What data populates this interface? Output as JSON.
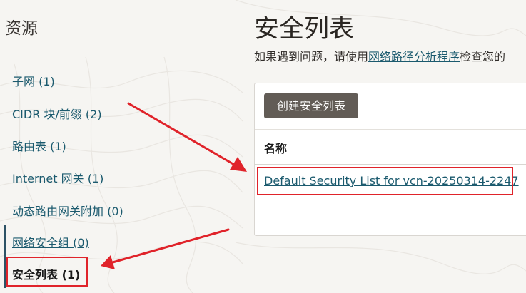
{
  "sidebar": {
    "title": "资源",
    "items": [
      {
        "label": "子网 (1)"
      },
      {
        "label": "CIDR 块/前缀 (2)"
      },
      {
        "label": "路由表 (1)"
      },
      {
        "label": "Internet 网关 (1)"
      },
      {
        "label": "动态路由网关附加 (0)"
      },
      {
        "label": "网络安全组 (0)"
      },
      {
        "label": "安全列表 (1)"
      }
    ]
  },
  "main": {
    "title": "安全列表",
    "description_prefix": "如果遇到问题，请使用",
    "description_link": "网络路径分析程序",
    "description_suffix": "检查您的",
    "create_button": "创建安全列表",
    "table": {
      "column_name": "名称",
      "rows": [
        {
          "name": "Default Security List for vcn-20250314-2247"
        }
      ]
    }
  },
  "colors": {
    "link": "#1b5a6e",
    "button": "#625c56",
    "annotation": "#e0232a"
  }
}
